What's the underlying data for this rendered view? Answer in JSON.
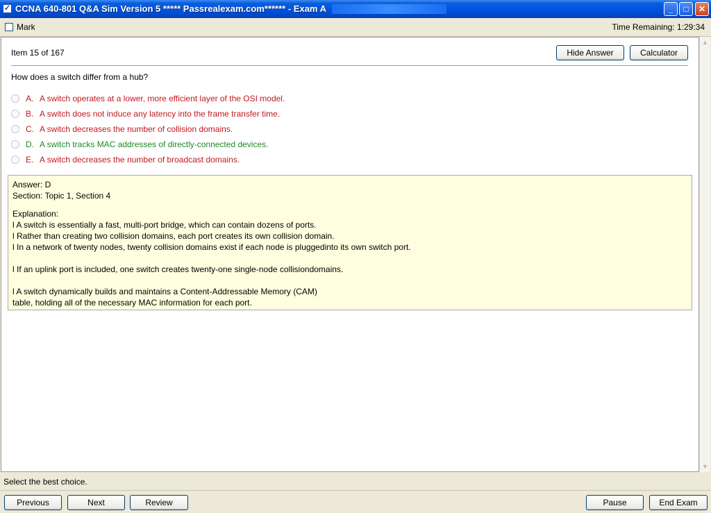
{
  "window": {
    "title": "CCNA 640-801 Q&A Sim Version 5 ***** Passrealexam.com****** - Exam A",
    "app_icon": "checkbox-icon",
    "controls": {
      "minimize": "_",
      "maximize": "□",
      "close": "✕"
    },
    "accent": "#0054e3"
  },
  "markbar": {
    "mark_label": "Mark",
    "time_remaining": "Time Remaining: 1:29:34"
  },
  "question": {
    "counter": "Item 15 of 167",
    "hide_answer_label": "Hide Answer",
    "calculator_label": "Calculator",
    "text": "How does a switch differ from a hub?",
    "choices": [
      {
        "letter": "A.",
        "text": "A switch operates at a lower, more efficient layer of the OSI model.",
        "status": "wrong"
      },
      {
        "letter": "B.",
        "text": "A switch does not induce any latency into the frame transfer time.",
        "status": "wrong"
      },
      {
        "letter": "C.",
        "text": "A switch decreases the number of collision domains.",
        "status": "wrong"
      },
      {
        "letter": "D.",
        "text": "A switch tracks MAC addresses of directly-connected devices.",
        "status": "correct"
      },
      {
        "letter": "E.",
        "text": "A switch decreases the number of broadcast domains.",
        "status": "wrong"
      }
    ],
    "colors": {
      "wrong": "#c0191f",
      "correct": "#1f8a24",
      "answer_bg": "#ffffe0"
    }
  },
  "answer": {
    "answer_line": "Answer: D",
    "section_line": "Section: Topic 1, Section 4",
    "explanation_label": "Explanation:",
    "lines": [
      "l A switch is essentially a fast, multi-port bridge, which can contain dozens of ports.",
      "l Rather than creating two collision domains, each port creates its own collision domain.",
      "l In a network of twenty nodes, twenty collision domains exist if each node is pluggedinto its own switch port.",
      "l If an uplink port is included, one switch creates twenty-one single-node collisiondomains.",
      "l A switch dynamically builds and maintains a Content-Addressable Memory (CAM)",
      "table, holding all of the necessary MAC information for each port."
    ]
  },
  "status_text": "Select the best choice.",
  "nav": {
    "previous": "Previous",
    "next": "Next",
    "review": "Review",
    "pause": "Pause",
    "end_exam": "End Exam"
  }
}
